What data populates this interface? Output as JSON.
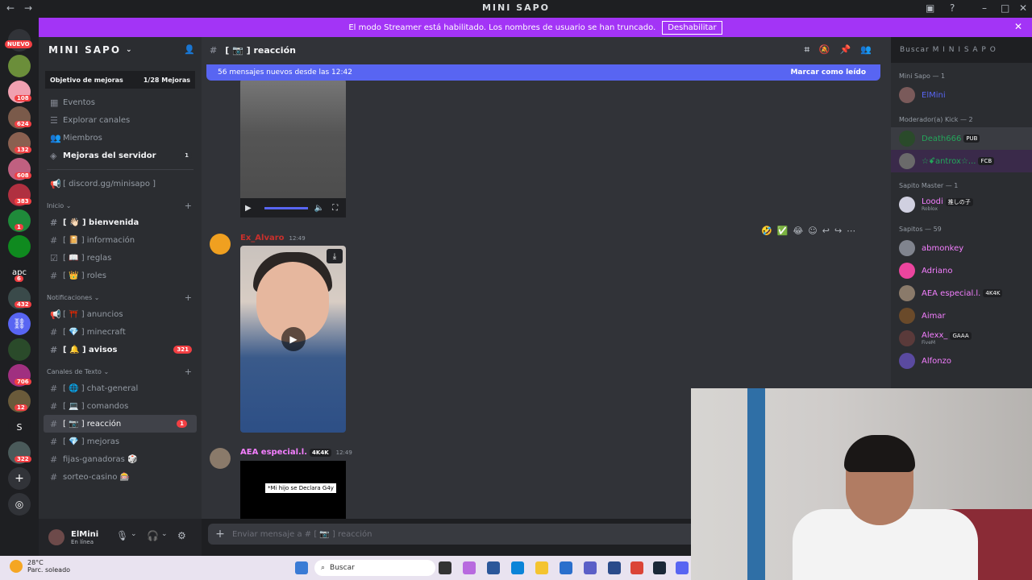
{
  "window": {
    "title": "MINI SAPO"
  },
  "banner": {
    "text": "El modo Streamer está habilitado. Los nombres de usuario se han truncado.",
    "button": "Deshabilitar"
  },
  "servers": {
    "new_label": "NUEVO",
    "badges": [
      "108",
      "624",
      "132",
      "608",
      "383",
      "1",
      "6",
      "432",
      "706",
      "12",
      "322"
    ],
    "apc": "apc",
    "s": "S"
  },
  "guild": {
    "name": "MINI SAPO",
    "goal_label": "Objetivo de mejoras",
    "goal_value": "1/28 Mejoras",
    "top_items": [
      "Eventos",
      "Explorar canales",
      "Miembros",
      "Mejoras del servidor"
    ],
    "boost_count": "1",
    "invite": "[ discord.gg/minisapo ]",
    "categories": [
      {
        "name": "Inicio",
        "channels": [
          "[ 👋🏻 ] bienvenida",
          "[ 📔 ] información",
          "[ 📖 ] reglas",
          "[ 👑 ] roles"
        ]
      },
      {
        "name": "Notificaciones",
        "channels": [
          "[ ⛩️ ] anuncios",
          "[ 💎 ] minecraft",
          "[ 🔔 ] avisos"
        ]
      },
      {
        "name": "Canales de Texto",
        "channels": [
          "[ 🌐 ] chat-general",
          "[ 💻 ] comandos",
          "[ 📷 ] reacción",
          "[ 💎 ] mejoras",
          "fijas-ganadoras 🎲",
          "sorteo-casino 🎰"
        ]
      }
    ],
    "avisos_badge": "321",
    "reaccion_badge": "1"
  },
  "user": {
    "name": "ElMini",
    "status": "En línea"
  },
  "chat": {
    "channel": "[ 📷 ] reacción",
    "new_messages": "56 mensajes nuevos desde las 12:42",
    "mark_read": "Marcar como leído",
    "messages": [
      {
        "author": "Ex_Alvaro",
        "time": "12:49"
      },
      {
        "author": "AEA especial.l.",
        "tag": "4K4K",
        "time": "12:49",
        "caption": "*Mi hijo se Declara G4y"
      }
    ],
    "composer_placeholder": "Enviar mensaje a # [ 📷 ] reacción"
  },
  "search": {
    "placeholder": "Buscar M I N I  S A P O"
  },
  "members": {
    "groups": [
      {
        "name": "Mini Sapo — 1",
        "members": [
          {
            "name": "ElMini",
            "color": "#5865f2"
          }
        ]
      },
      {
        "name": "Moderador(a) Kick — 2",
        "members": [
          {
            "name": "Death666",
            "color": "#23a55a",
            "tag": "PUB"
          },
          {
            "name": "☆ꗄantrox☆...",
            "color": "#23a55a",
            "tag": "FCB"
          }
        ]
      },
      {
        "name": "Sapito Master — 1",
        "members": [
          {
            "name": "Loodi",
            "color": "#f47fff",
            "tag": "推しの子",
            "sub": "Roblox"
          }
        ]
      },
      {
        "name": "Sapitos — 59",
        "members": [
          {
            "name": "abmonkey",
            "color": "#f47fff"
          },
          {
            "name": "Adriano",
            "color": "#f47fff"
          },
          {
            "name": "AEA especial.l.",
            "color": "#f47fff",
            "tag": "4K4K"
          },
          {
            "name": "Aimar",
            "color": "#f47fff"
          },
          {
            "name": "Alexx_",
            "color": "#f47fff",
            "tag": "GAAA",
            "sub": "FiveM"
          },
          {
            "name": "Alfonzo",
            "color": "#f47fff"
          }
        ]
      }
    ]
  },
  "taskbar": {
    "temp": "28°C",
    "weather": "Parc. soleado",
    "search": "Buscar"
  }
}
